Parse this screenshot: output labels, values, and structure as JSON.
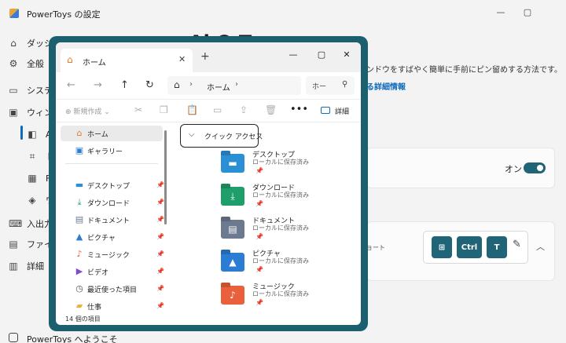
{
  "powertoys": {
    "title": "PowerToys の設定",
    "caption": {
      "minimize": "—",
      "maximize": "▢"
    },
    "nav": [
      {
        "label": "ダッシュ",
        "icon": "home-icon"
      },
      {
        "label": "全般",
        "icon": "gear-icon"
      },
      {
        "label": "システム",
        "icon": "monitor-icon"
      },
      {
        "label": "ウィンド",
        "icon": "window-icon"
      },
      {
        "label": "A",
        "icon": "always-on-top-icon"
      },
      {
        "label": "ト",
        "icon": "crop-icon"
      },
      {
        "label": "Fa",
        "icon": "fancyzones-icon"
      },
      {
        "label": "ワ",
        "icon": "workspaces-icon"
      },
      {
        "label": "入出力",
        "icon": "keyboard-icon"
      },
      {
        "label": "ファイル",
        "icon": "file-icon"
      },
      {
        "label": "詳細",
        "icon": "advanced-icon"
      }
    ],
    "heading": "Al    O   T",
    "description": "ンドウをすばやく簡単に手前にピン留めする方法です。",
    "link": "る詳細情報",
    "toggle_label": "オン",
    "shortcut_hint": "ョート",
    "keys": [
      "⊞",
      "Ctrl",
      "T"
    ],
    "welcome": "PowerToys へようこそ"
  },
  "explorer": {
    "tab_label": "ホーム",
    "address": "ホーム",
    "search_placeholder": "ホー",
    "toolbar": {
      "new_label": "新規作成",
      "details_label": "詳細",
      "more": "•••"
    },
    "sidebar": [
      {
        "label": "ホーム",
        "icon": "home-icon",
        "color": "#e47a2e",
        "pinned": false,
        "selected": true
      },
      {
        "label": "ギャラリー",
        "icon": "gallery-icon",
        "color": "#2b7cd3",
        "pinned": false,
        "selected": false
      },
      {
        "label": "デスクトップ",
        "icon": "desktop-icon",
        "color": "#2b8fd6",
        "pinned": true,
        "selected": false
      },
      {
        "label": "ダウンロード",
        "icon": "download-icon",
        "color": "#1e9e6a",
        "pinned": true,
        "selected": false
      },
      {
        "label": "ドキュメント",
        "icon": "document-icon",
        "color": "#6b7a8f",
        "pinned": true,
        "selected": false
      },
      {
        "label": "ピクチャ",
        "icon": "pictures-icon",
        "color": "#2b7cd3",
        "pinned": true,
        "selected": false
      },
      {
        "label": "ミュージック",
        "icon": "music-icon",
        "color": "#e8603c",
        "pinned": true,
        "selected": false
      },
      {
        "label": "ビデオ",
        "icon": "video-icon",
        "color": "#7b4fc9",
        "pinned": true,
        "selected": false
      },
      {
        "label": "最近使った項目",
        "icon": "recent-icon",
        "color": "#555555",
        "pinned": true,
        "selected": false
      },
      {
        "label": "仕事",
        "icon": "folder-icon",
        "color": "#e8b341",
        "pinned": true,
        "selected": false
      }
    ],
    "quick_access": "クイック アクセス",
    "folders": [
      {
        "name": "デスクトップ",
        "sub": "ローカルに保存済み",
        "icon": "desktop-folder-icon",
        "color": "#2b8fd6"
      },
      {
        "name": "ダウンロード",
        "sub": "ローカルに保存済み",
        "icon": "download-folder-icon",
        "color": "#1e9e6a"
      },
      {
        "name": "ドキュメント",
        "sub": "ローカルに保存済み",
        "icon": "documents-folder-icon",
        "color": "#6b7a8f"
      },
      {
        "name": "ピクチャ",
        "sub": "ローカルに保存済み",
        "icon": "pictures-folder-icon",
        "color": "#2b7cd3"
      },
      {
        "name": "ミュージック",
        "sub": "ローカルに保存済み",
        "icon": "music-folder-icon",
        "color": "#e8603c"
      }
    ],
    "status": "14 個の項目"
  },
  "colors": {
    "accent": "#1f6477",
    "link": "#0f6cbd",
    "frame": "#1c5f6e"
  }
}
